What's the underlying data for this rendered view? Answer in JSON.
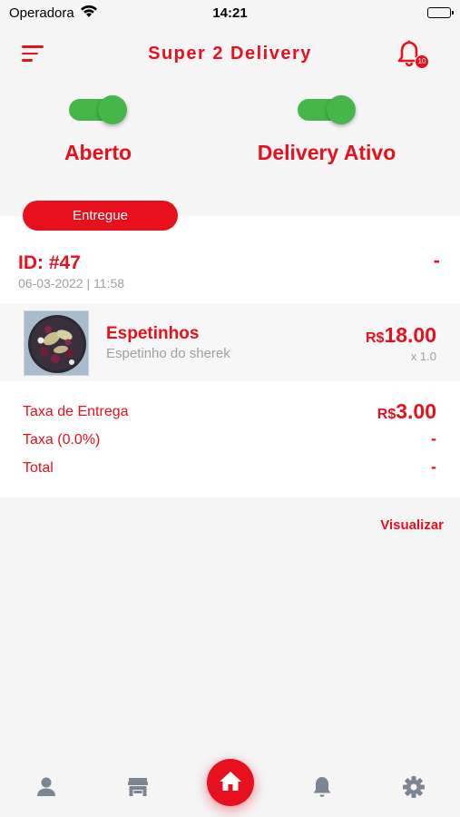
{
  "status_bar": {
    "carrier": "Operadora",
    "time": "14:21"
  },
  "header": {
    "title": "Super 2 Delivery",
    "notification_count": "10"
  },
  "toggles": [
    {
      "label": "Aberto",
      "on": true
    },
    {
      "label": "Delivery Ativo",
      "on": true
    }
  ],
  "order": {
    "status": "Entregue",
    "id": "ID: #47",
    "date": "06-03-2022 | 11:58",
    "dash": "-",
    "item": {
      "name": "Espetinhos",
      "description": "Espetinho do sherek",
      "currency": "R$",
      "price": "18.00",
      "qty": "x 1.0"
    },
    "fees": {
      "delivery_label": "Taxa de Entrega",
      "delivery_currency": "R$",
      "delivery_value": "3.00",
      "tax_label": "Taxa (0.0%)",
      "tax_value": "-",
      "total_label": "Total",
      "total_value": "-"
    }
  },
  "view_label": "Visualizar",
  "nav": {
    "icons": [
      "user-icon",
      "store-icon",
      "home-icon",
      "bell-icon",
      "gear-icon"
    ],
    "active_color": "#e8101c",
    "inactive_color": "#7b8593"
  },
  "colors": {
    "accent": "#e8101c",
    "toggle_on": "#45b649",
    "muted": "#a0a0a0"
  }
}
